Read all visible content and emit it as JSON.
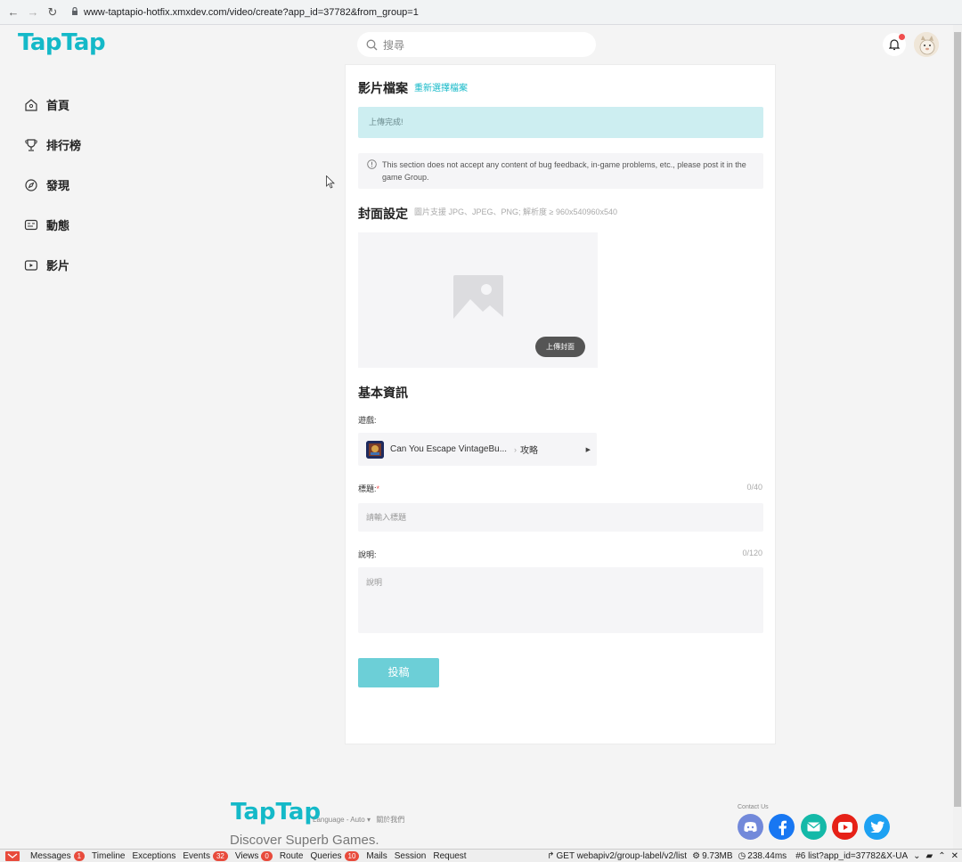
{
  "browser": {
    "url": "www-taptapio-hotfix.xmxdev.com/video/create?app_id=37782&from_group=1"
  },
  "header": {
    "logo": "TapTap",
    "search_placeholder": "搜尋"
  },
  "sidebar": {
    "items": [
      {
        "label": "首頁",
        "icon": "home-icon"
      },
      {
        "label": "排行榜",
        "icon": "trophy-icon"
      },
      {
        "label": "發現",
        "icon": "compass-icon"
      },
      {
        "label": "動態",
        "icon": "chat-icon"
      },
      {
        "label": "影片",
        "icon": "video-icon"
      }
    ]
  },
  "form": {
    "video_section_title": "影片檔案",
    "reselect_link": "重新選擇檔案",
    "upload_status": "上傳完成!",
    "notice": "This section does not accept any content of bug feedback, in-game problems, etc., please post it in the game Group.",
    "cover_section_title": "封面設定",
    "cover_hint": "圖片支援 JPG、JPEG、PNG; 解析度 ≥ 960x540960x540",
    "upload_cover_button": "上傳封面",
    "basic_info_title": "基本資訊",
    "game_label": "遊戲:",
    "game_name": "Can You Escape VintageBu...",
    "game_category": "攻略",
    "title_label": "標題:",
    "title_required": "*",
    "title_counter": "0/40",
    "title_placeholder": "請輸入標題",
    "desc_label": "說明:",
    "desc_counter": "0/120",
    "desc_placeholder": "說明",
    "submit_label": "投稿"
  },
  "footer": {
    "logo": "TapTap",
    "language": "Language - Auto ▾",
    "about": "關於我們",
    "slogan": "Discover Superb Games.",
    "contact": "Contact Us"
  },
  "debugbar": {
    "messages": "Messages",
    "messages_count": "1",
    "timeline": "Timeline",
    "exceptions": "Exceptions",
    "events": "Events",
    "events_count": "32",
    "views": "Views",
    "views_count": "0",
    "route": "Route",
    "queries": "Queries",
    "queries_count": "10",
    "mails": "Mails",
    "session": "Session",
    "request": "Request",
    "request_info": "GET webapiv2/group-label/v2/list",
    "memory": "9.73MB",
    "time": "238.44ms",
    "request_select": "#6 list?app_id=37782&X-UA"
  },
  "colors": {
    "brand": "#14b9c8",
    "submit": "#6ccfd7",
    "success_bg": "#cdeef1",
    "badge": "#e84b3c"
  }
}
